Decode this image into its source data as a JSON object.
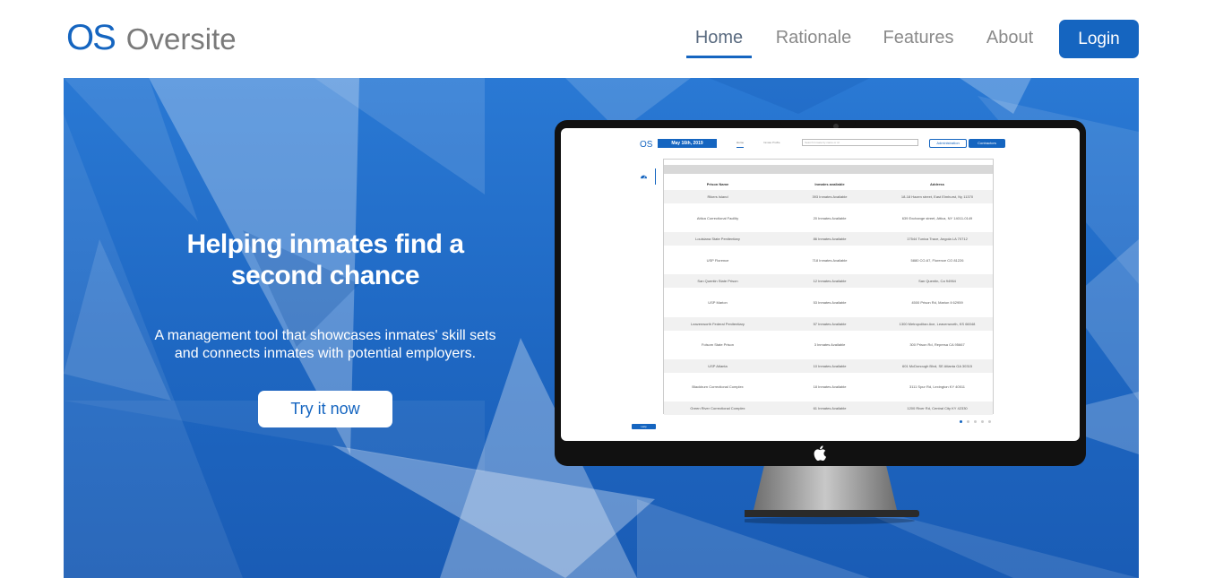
{
  "brand": {
    "mark": "OS",
    "name": "Oversite"
  },
  "nav": {
    "items": [
      {
        "label": "Home",
        "active": true
      },
      {
        "label": "Rationale",
        "active": false
      },
      {
        "label": "Features",
        "active": false
      },
      {
        "label": "About",
        "active": false
      }
    ],
    "login_label": "Login"
  },
  "hero": {
    "title": "Helping inmates find a second chance",
    "subtitle": "A management tool that showcases inmates' skill sets and connects inmates with potential employers.",
    "cta_label": "Try it now"
  },
  "screen": {
    "logo": "OS",
    "date": "May 16th, 2019",
    "tabs": [
      "Home",
      "Inmate Profile"
    ],
    "search_placeholder": "Search Inmate by name or id",
    "admin_label": "Administration",
    "contractors_label": "Contractors",
    "help_label": "Help",
    "table": {
      "headers": [
        "Prison Name",
        "Inmates available",
        "Address"
      ],
      "rows": [
        [
          "Rikers Island",
          "393 Inmates Available",
          "18-18 Hazen street, East Elmhurst, Ny 11370"
        ],
        [
          "Attica Correctional Facility",
          "20 Inmates Available",
          "639 Exchange street, Attica, NY 14011-0149"
        ],
        [
          "Louisiana State Penitentiary",
          "86 Inmates Available",
          "17544 Tunica Trace, Angola LA 70712"
        ],
        [
          "USP Florence",
          "718 Inmates Available",
          "5880 CO-67, Florence CO 81226"
        ],
        [
          "San Quentin State Prison",
          "12 Inmates Available",
          "San Quentin, Ca 94964"
        ],
        [
          "USP Marion",
          "53 Inmates Available",
          "4500 Prison Rd, Marion Il 62959"
        ],
        [
          "Leavenworth Federal Penitentiary",
          "57 Inmates Available",
          "1300 Metropolitan Ave, Leavenworth, KS 66048"
        ],
        [
          "Folsom State Prison",
          "3 Inmates Available",
          "300 Prison Rd, Represa CA 95667"
        ],
        [
          "USP Atlanta",
          "10 Inmates Available",
          "601 McDonough Blvd, SE Atlanta GA 30315"
        ],
        [
          "Blackburn Correctional Complex",
          "18 Inmates Available",
          "3111 Spur Rd, Lexington KY 40511"
        ],
        [
          "Green River Correctional Complex",
          "61 Inmates Available",
          "1200 River Rd, Central City KY 42330"
        ]
      ]
    },
    "pagination": {
      "pages": 5,
      "current": 1
    }
  },
  "colors": {
    "primary": "#1565c0",
    "hero_bg": "#1e67c2",
    "nav_text": "#8a8a8a"
  },
  "icons": {
    "monitor_logo": "apple-icon",
    "sidebar": "dashboard-gauge-icon"
  }
}
